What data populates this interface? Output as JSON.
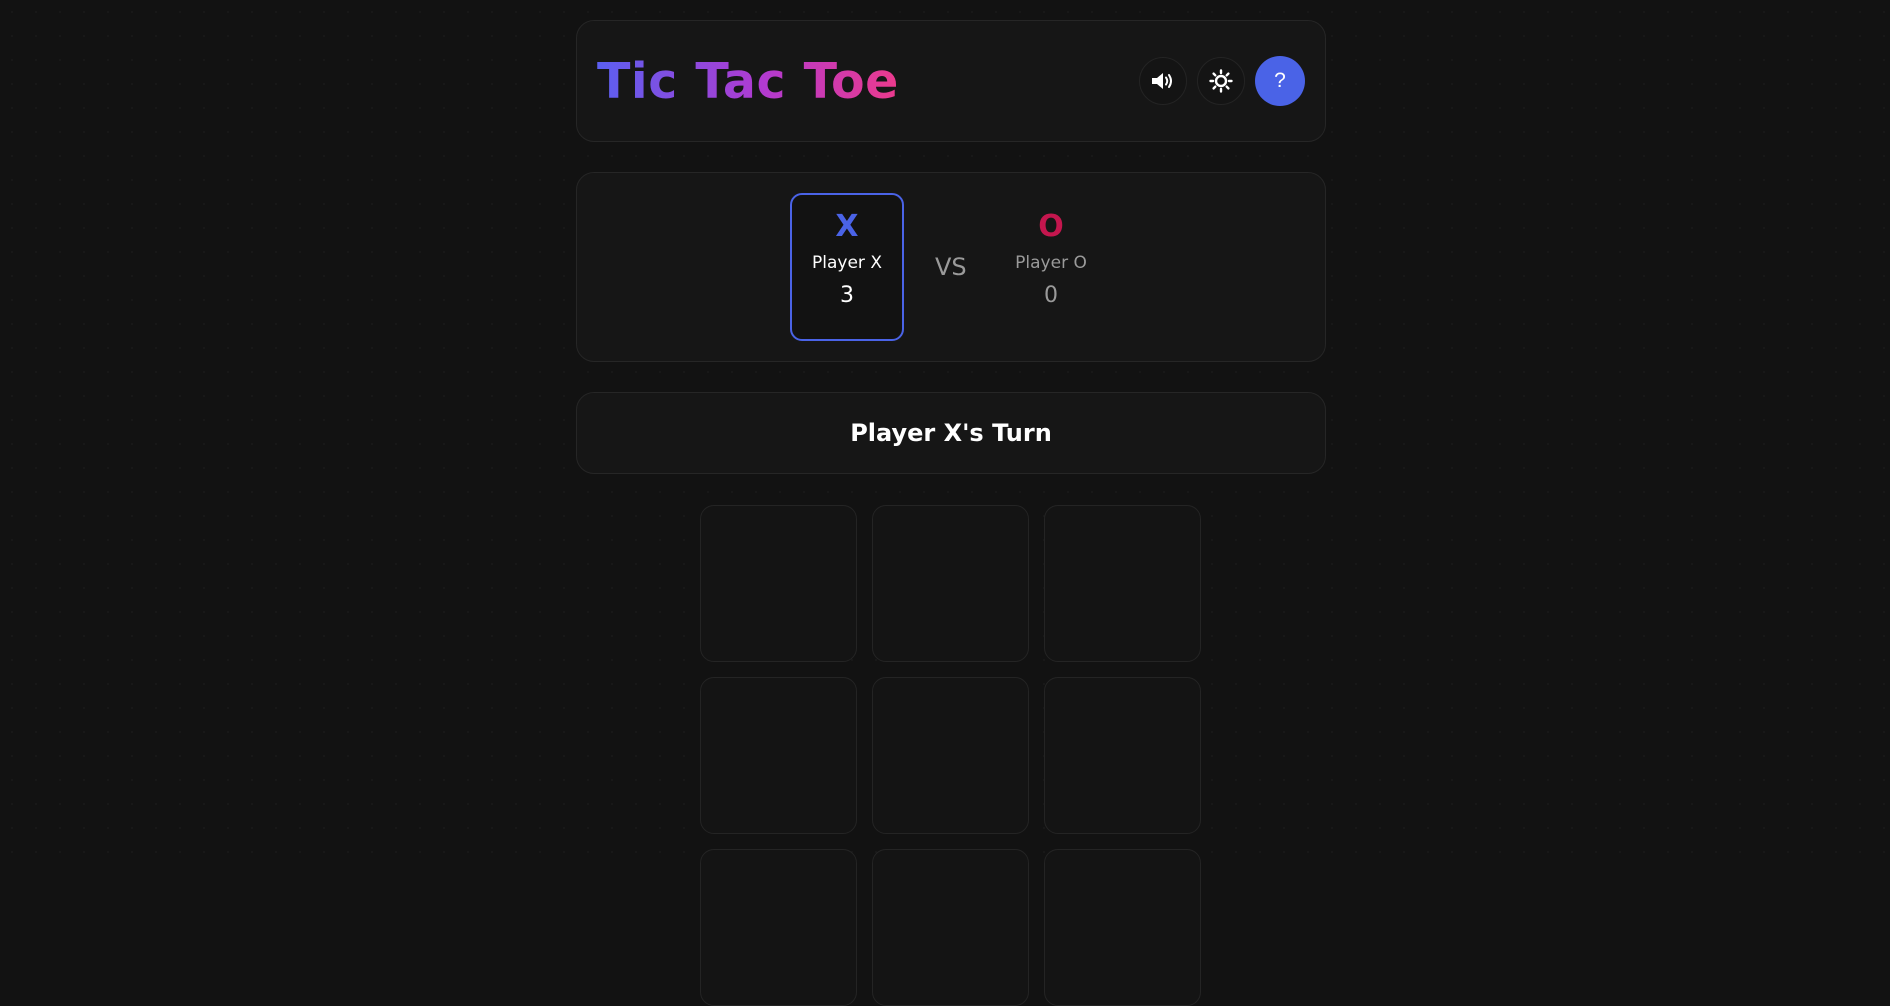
{
  "header": {
    "title": "Tic Tac Toe",
    "buttons": [
      {
        "name": "sound",
        "icon": "speaker-volume-icon"
      },
      {
        "name": "theme",
        "icon": "sun-icon"
      },
      {
        "name": "help",
        "icon": "question-mark-icon",
        "label": "?"
      }
    ]
  },
  "scores": {
    "player_x": {
      "symbol": "X",
      "name": "Player X",
      "score": "3",
      "active": true
    },
    "vs": "VS",
    "player_o": {
      "symbol": "O",
      "name": "Player O",
      "score": "0",
      "active": false
    }
  },
  "status": {
    "text": "Player X's Turn"
  },
  "board": {
    "cells": [
      "",
      "",
      "",
      "",
      "",
      "",
      "",
      "",
      ""
    ]
  },
  "colors": {
    "accent": "#4a63e7",
    "x_color": "#4a63e7",
    "o_color": "#c4164e",
    "background": "#121212",
    "panel": "#161616"
  }
}
